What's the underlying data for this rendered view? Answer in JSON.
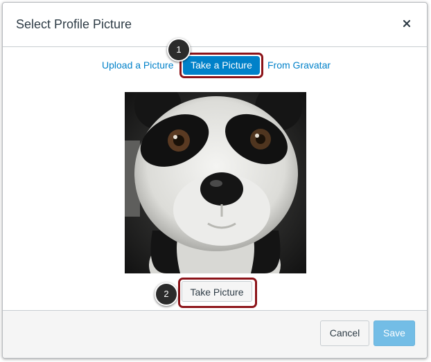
{
  "dialog": {
    "title": "Select Profile Picture",
    "close_icon": "close-icon"
  },
  "tabs": {
    "items": [
      {
        "label": "Upload a Picture",
        "active": false
      },
      {
        "label": "Take a Picture",
        "active": true
      },
      {
        "label": "From Gravatar",
        "active": false
      }
    ]
  },
  "callouts": [
    "1",
    "2"
  ],
  "preview": {
    "image": "webcam-preview-panda-plush"
  },
  "capture": {
    "take_label": "Take Picture"
  },
  "footer": {
    "cancel_label": "Cancel",
    "save_label": "Save"
  },
  "colors": {
    "link": "#0081c9",
    "active_tab_bg": "#0081c9",
    "highlight_border": "#8c1318",
    "save_disabled": "#73bde6"
  }
}
